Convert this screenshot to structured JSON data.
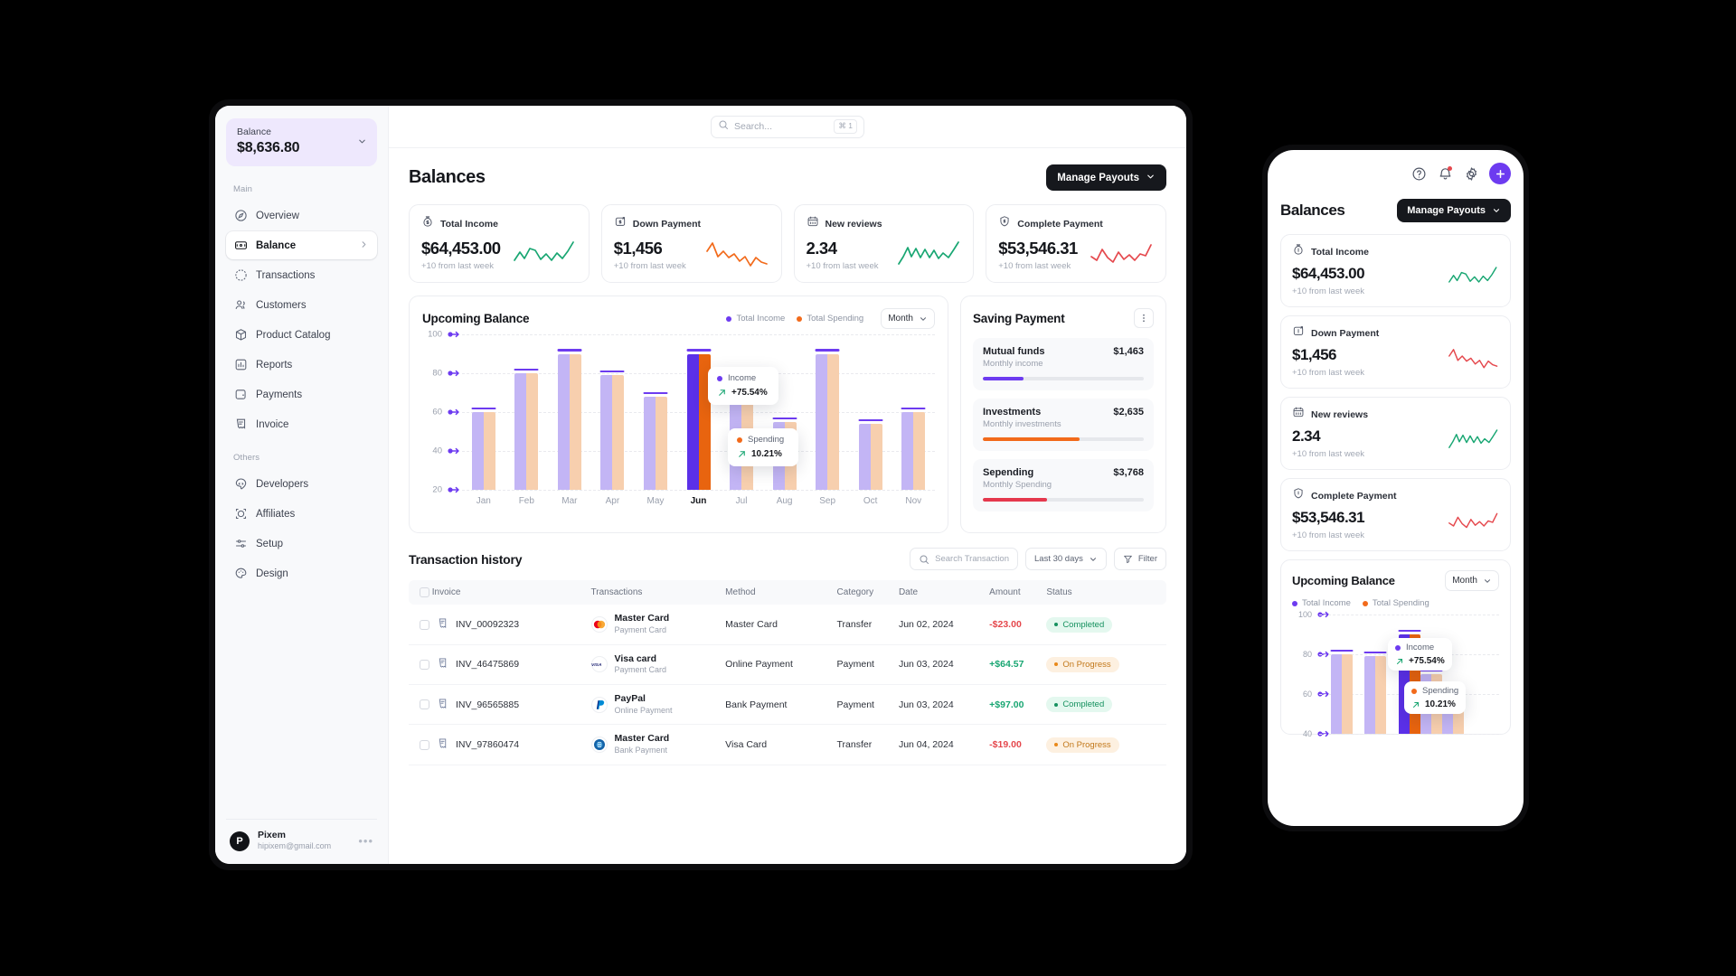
{
  "sidebar": {
    "balance_label": "Balance",
    "balance_amount": "$8,636.80",
    "section_main": "Main",
    "section_others": "Others",
    "main_items": [
      {
        "label": "Overview",
        "icon": "compass-icon"
      },
      {
        "label": "Balance",
        "icon": "wallet-icon"
      },
      {
        "label": "Transactions",
        "icon": "dollar-circle-icon"
      },
      {
        "label": "Customers",
        "icon": "users-icon"
      },
      {
        "label": "Product Catalog",
        "icon": "box-icon"
      },
      {
        "label": "Reports",
        "icon": "chart-bar-icon"
      },
      {
        "label": "Payments",
        "icon": "card-icon"
      },
      {
        "label": "Invoice",
        "icon": "file-icon"
      }
    ],
    "other_items": [
      {
        "label": "Developers",
        "icon": "code-icon"
      },
      {
        "label": "Affiliates",
        "icon": "affiliate-icon"
      },
      {
        "label": "Setup",
        "icon": "sliders-icon"
      },
      {
        "label": "Design",
        "icon": "palette-icon"
      }
    ],
    "user": {
      "initial": "P",
      "name": "Pixem",
      "email": "hipixem@gmail.com",
      "menu": "•••"
    }
  },
  "topbar": {
    "search_placeholder": "Search...",
    "shortcut": "⌘ 1"
  },
  "header": {
    "title": "Balances",
    "manage_payouts": "Manage Payouts"
  },
  "stats": [
    {
      "title": "Total Income",
      "value": "$64,453.00",
      "sub": "+10 from last week",
      "icon": "money-bag-icon",
      "color": "#18a672"
    },
    {
      "title": "Down Payment",
      "value": "$1,456",
      "sub": "+10 from last week",
      "icon": "money-in-icon",
      "color": "#f26a1b"
    },
    {
      "title": "New reviews",
      "value": "2.34",
      "sub": "+10 from last week",
      "icon": "calendar-icon",
      "color": "#18a672"
    },
    {
      "title": "Complete Payment",
      "value": "$53,546.31",
      "sub": "+10 from last week",
      "icon": "shield-dollar-icon",
      "color": "#e5484d"
    }
  ],
  "chart_data": {
    "type": "bar",
    "title": "Upcoming Balance",
    "categories": [
      "Jan",
      "Feb",
      "Mar",
      "Apr",
      "May",
      "Jun",
      "Jul",
      "Aug",
      "Sep",
      "Oct",
      "Nov"
    ],
    "series": [
      {
        "name": "Total Income",
        "color": "#6d3bf0",
        "values": [
          60,
          80,
          90,
          79,
          68,
          90,
          70,
          55,
          90,
          54,
          60
        ]
      },
      {
        "name": "Total Spending",
        "color": "#f26a1b",
        "values": [
          60,
          80,
          90,
          79,
          68,
          90,
          70,
          55,
          90,
          54,
          60
        ]
      }
    ],
    "ylabel": "",
    "xlabel": "",
    "yticks": [
      100,
      80,
      60,
      40,
      20
    ],
    "ylim": [
      20,
      100
    ],
    "grid": true,
    "legend_position": "top-right",
    "highlight_category": "Jun",
    "period_selector": "Month",
    "annotations": [
      {
        "label": "Income",
        "value": "+75.54%",
        "color": "#6d3bf0"
      },
      {
        "label": "Spending",
        "value": "10.21%",
        "color": "#f26a1b"
      }
    ]
  },
  "saving": {
    "title": "Saving Payment",
    "menu_icon": "kebab-menu-icon",
    "items": [
      {
        "name": "Mutual funds",
        "amount": "$1,463",
        "sub": "Monthly income",
        "percent": 25,
        "color": "#6d3bf0"
      },
      {
        "name": "Investments",
        "amount": "$2,635",
        "sub": "Monthly investments",
        "percent": 60,
        "color": "#f26a1b"
      },
      {
        "name": "Sepending",
        "amount": "$3,768",
        "sub": "Monthly Spending",
        "percent": 40,
        "color": "#e5384d"
      }
    ]
  },
  "transactions": {
    "title": "Transaction history",
    "search_placeholder": "Search Transaction",
    "range": "Last 30 days",
    "filter": "Filter",
    "columns": [
      "Invoice",
      "Transactions",
      "Method",
      "Category",
      "Date",
      "Amount",
      "Status"
    ],
    "rows": [
      {
        "invoice": "INV_00092323",
        "name": "Master Card",
        "type": "Payment Card",
        "brand": "mastercard",
        "method": "Master Card",
        "category": "Transfer",
        "date": "Jun 02, 2024",
        "amount": "-$23.00",
        "sign": "neg",
        "status": "Completed",
        "state": "done"
      },
      {
        "invoice": "INV_46475869",
        "name": "Visa card",
        "type": "Payment Card",
        "brand": "visa",
        "method": "Online Payment",
        "category": "Payment",
        "date": "Jun 03, 2024",
        "amount": "+$64.57",
        "sign": "pos",
        "status": "On Progress",
        "state": "prog"
      },
      {
        "invoice": "INV_96565885",
        "name": "PayPal",
        "type": "Online Payment",
        "brand": "paypal",
        "method": "Bank Payment",
        "category": "Payment",
        "date": "Jun 03, 2024",
        "amount": "+$97.00",
        "sign": "pos",
        "status": "Completed",
        "state": "done"
      },
      {
        "invoice": "INV_97860474",
        "name": "Master Card",
        "type": "Bank Payment",
        "brand": "bank",
        "method": "Visa Card",
        "category": "Transfer",
        "date": "Jun 04, 2024",
        "amount": "-$19.00",
        "sign": "neg",
        "status": "On Progress",
        "state": "prog"
      }
    ]
  },
  "mobile": {
    "icons": [
      "help-circle-icon",
      "bell-icon",
      "gear-icon",
      "plus-icon"
    ],
    "title": "Balances",
    "manage_payouts": "Manage Payouts",
    "chart_title": "Upcoming Balance",
    "period": "Month",
    "yticks": [
      100,
      80,
      60,
      40
    ]
  }
}
